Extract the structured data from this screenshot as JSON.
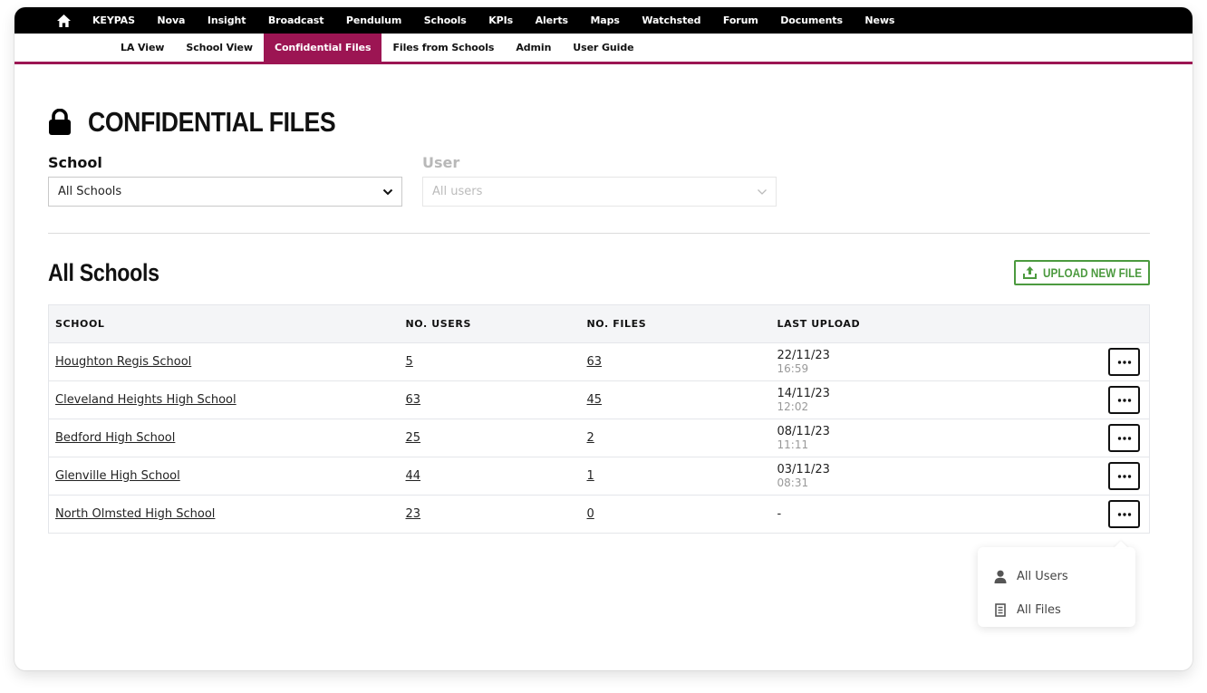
{
  "topnav": {
    "home_icon": "home-icon",
    "items": [
      "KEYPAS",
      "Nova",
      "Insight",
      "Broadcast",
      "Pendulum",
      "Schools",
      "KPIs",
      "Alerts",
      "Maps",
      "Watchsted",
      "Forum",
      "Documents",
      "News"
    ]
  },
  "subnav": {
    "items": [
      "LA View",
      "School View",
      "Confidential Files",
      "Files from Schools",
      "Admin",
      "User Guide"
    ],
    "active": "Confidential Files"
  },
  "colors": {
    "accent": "#9c1553",
    "upload_green": "#4c9a3f"
  },
  "page": {
    "title_icon": "lock-icon",
    "title": "CONFIDENTIAL FILES"
  },
  "filters": {
    "school": {
      "label": "School",
      "value": "All Schools"
    },
    "user": {
      "label": "User",
      "value": "All users",
      "disabled": true
    }
  },
  "section": {
    "title": "All Schools",
    "upload_button": {
      "icon": "upload-icon",
      "label": "UPLOAD NEW FILE"
    }
  },
  "table": {
    "headers": [
      "SCHOOL",
      "NO. USERS",
      "NO. FILES",
      "LAST UPLOAD"
    ],
    "rows": [
      {
        "school": "Houghton Regis School",
        "users": "5",
        "files": "63",
        "date": "22/11/23",
        "time": "16:59"
      },
      {
        "school": "Cleveland Heights High School",
        "users": "63",
        "files": "45",
        "date": "14/11/23",
        "time": "12:02"
      },
      {
        "school": "Bedford High School",
        "users": "25",
        "files": "2",
        "date": "08/11/23",
        "time": "11:11"
      },
      {
        "school": "Glenville High School",
        "users": "44",
        "files": "1",
        "date": "03/11/23",
        "time": "08:31"
      },
      {
        "school": "North Olmsted High School",
        "users": "23",
        "files": "0",
        "date": "-",
        "time": ""
      }
    ]
  },
  "row_menu": {
    "open_for_row": 4,
    "items": [
      {
        "icon": "user-icon",
        "label": "All Users"
      },
      {
        "icon": "document-icon",
        "label": "All Files"
      }
    ]
  }
}
